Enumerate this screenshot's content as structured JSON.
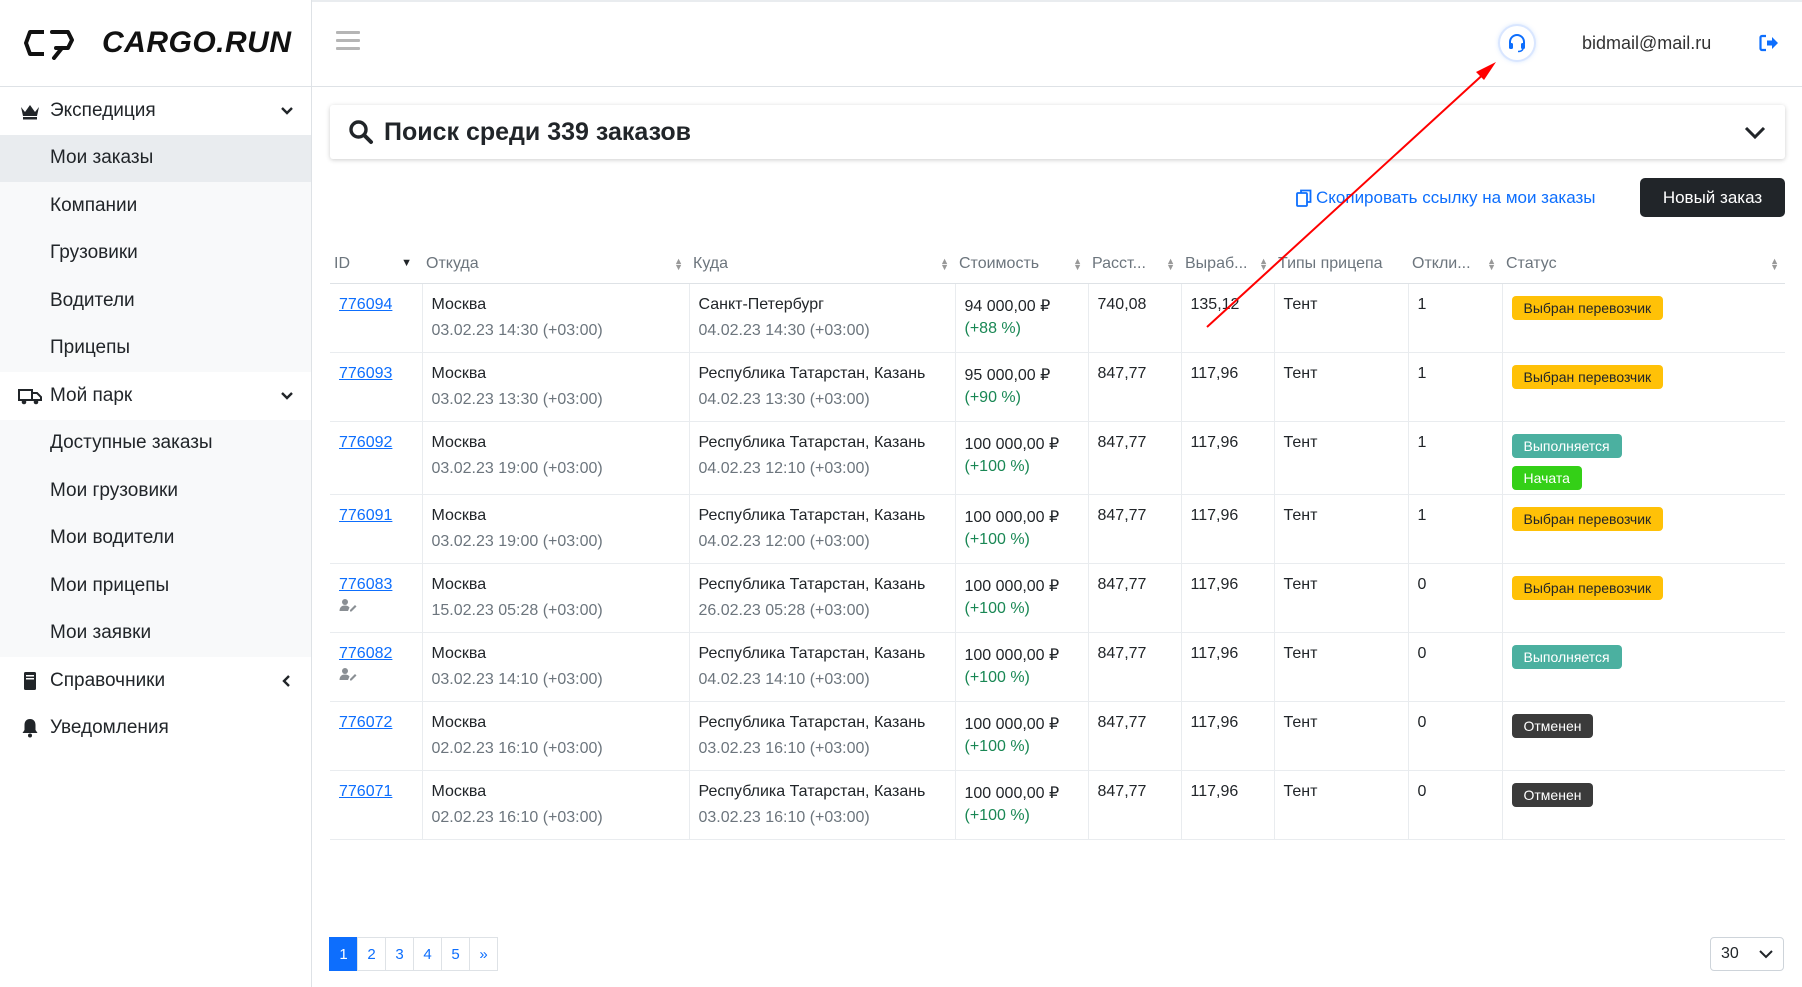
{
  "app": {
    "logo_text": "CARGO.RUN"
  },
  "sidebar": {
    "groups": [
      {
        "label": "Экспедиция",
        "items": [
          {
            "label": "Мои заказы",
            "active": true
          },
          {
            "label": "Компании"
          },
          {
            "label": "Грузовики"
          },
          {
            "label": "Водители"
          },
          {
            "label": "Прицепы"
          }
        ]
      },
      {
        "label": "Мой парк",
        "items": [
          {
            "label": "Доступные заказы"
          },
          {
            "label": "Мои грузовики"
          },
          {
            "label": "Мои водители"
          },
          {
            "label": "Мои прицепы"
          },
          {
            "label": "Мои заявки"
          }
        ]
      },
      {
        "label": "Справочники"
      },
      {
        "label": "Уведомления"
      }
    ]
  },
  "header": {
    "email": "bidmail@mail.ru"
  },
  "search": {
    "title": "Поиск среди 339 заказов"
  },
  "actions": {
    "copy_link": "Скопировать ссылку на мои заказы",
    "new_order": "Новый заказ"
  },
  "table": {
    "columns": [
      "ID",
      "Откуда",
      "Куда",
      "Стоимость",
      "Расст...",
      "Выраб...",
      "Типы прицепа",
      "Откли...",
      "Статус"
    ],
    "rows": [
      {
        "id": "776094",
        "from": "Москва",
        "from_date": "03.02.23 14:30 (+03:00)",
        "to": "Санкт-Петербург",
        "to_date": "04.02.23 14:30 (+03:00)",
        "price": "94 000,00 ₽",
        "pct": "(+88 %)",
        "dist": "740,08",
        "rate": "135,12",
        "trailer": "Тент",
        "responses": "1",
        "status": "Выбран перевозчик"
      },
      {
        "id": "776093",
        "from": "Москва",
        "from_date": "03.02.23 13:30 (+03:00)",
        "to": "Республика Татарстан, Казань",
        "to_date": "04.02.23 13:30 (+03:00)",
        "price": "95 000,00 ₽",
        "pct": "(+90 %)",
        "dist": "847,77",
        "rate": "117,96",
        "trailer": "Тент",
        "responses": "1",
        "status": "Выбран перевозчик"
      },
      {
        "id": "776092",
        "from": "Москва",
        "from_date": "03.02.23 19:00 (+03:00)",
        "to": "Республика Татарстан, Казань",
        "to_date": "04.02.23 12:10 (+03:00)",
        "price": "100 000,00 ₽",
        "pct": "(+100 %)",
        "dist": "847,77",
        "rate": "117,96",
        "trailer": "Тент",
        "responses": "1",
        "status": "Выполняется",
        "status2": "Начата"
      },
      {
        "id": "776091",
        "from": "Москва",
        "from_date": "03.02.23 19:00 (+03:00)",
        "to": "Республика Татарстан, Казань",
        "to_date": "04.02.23 12:00 (+03:00)",
        "price": "100 000,00 ₽",
        "pct": "(+100 %)",
        "dist": "847,77",
        "rate": "117,96",
        "trailer": "Тент",
        "responses": "1",
        "status": "Выбран перевозчик"
      },
      {
        "id": "776083",
        "from": "Москва",
        "from_date": "15.02.23 05:28 (+03:00)",
        "to": "Республика Татарстан, Казань",
        "to_date": "26.02.23 05:28 (+03:00)",
        "price": "100 000,00 ₽",
        "pct": "(+100 %)",
        "dist": "847,77",
        "rate": "117,96",
        "trailer": "Тент",
        "responses": "0",
        "status": "Выбран перевозчик"
      },
      {
        "id": "776082",
        "from": "Москва",
        "from_date": "03.02.23 14:10 (+03:00)",
        "to": "Республика Татарстан, Казань",
        "to_date": "04.02.23 14:10 (+03:00)",
        "price": "100 000,00 ₽",
        "pct": "(+100 %)",
        "dist": "847,77",
        "rate": "117,96",
        "trailer": "Тент",
        "responses": "0",
        "status": "Выполняется"
      },
      {
        "id": "776072",
        "from": "Москва",
        "from_date": "02.02.23 16:10 (+03:00)",
        "to": "Республика Татарстан, Казань",
        "to_date": "03.02.23 16:10 (+03:00)",
        "price": "100 000,00 ₽",
        "pct": "(+100 %)",
        "dist": "847,77",
        "rate": "117,96",
        "trailer": "Тент",
        "responses": "0",
        "status": "Отменен"
      },
      {
        "id": "776071",
        "from": "Москва",
        "from_date": "02.02.23 16:10 (+03:00)",
        "to": "Республика Татарстан, Казань",
        "to_date": "03.02.23 16:10 (+03:00)",
        "price": "100 000,00 ₽",
        "pct": "(+100 %)",
        "dist": "847,77",
        "rate": "117,96",
        "trailer": "Тент",
        "responses": "0",
        "status": "Отменен"
      }
    ]
  },
  "pagination": {
    "pages": [
      "1",
      "2",
      "3",
      "4",
      "5",
      "»"
    ],
    "current": "1",
    "per_page": "30"
  },
  "colors": {
    "accent": "#0d6efd",
    "status_yellow": "#ffc107",
    "status_teal": "#4bb0a0",
    "status_green": "#34d017",
    "status_dark": "#3b3b3b",
    "annotation_arrow": "#ff0000"
  },
  "icons": [
    "crown-icon",
    "truck-icon",
    "book-icon",
    "bell-icon",
    "search-icon",
    "headset-icon",
    "logout-icon",
    "copy-icon",
    "hamburger-icon",
    "chevron-down-icon",
    "chevron-left-icon",
    "user-edit-icon"
  ]
}
